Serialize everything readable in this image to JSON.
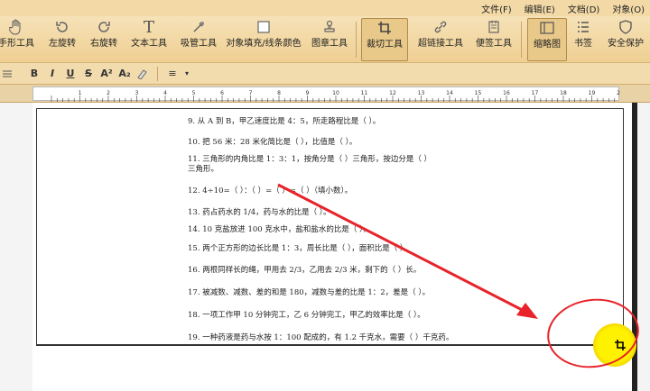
{
  "menu": [
    "文件(F)",
    "编辑(E)",
    "文档(D)",
    "对象(O)"
  ],
  "toolbar": [
    {
      "icon": "hand-icon",
      "label": "手形工具"
    },
    {
      "icon": "rotate-left-icon",
      "label": "左旋转"
    },
    {
      "icon": "rotate-right-icon",
      "label": "右旋转"
    },
    {
      "icon": "text-tool-icon",
      "label": "文本工具"
    },
    {
      "icon": "eyedropper-icon",
      "label": "吸管工具"
    },
    {
      "icon": "fill-stroke-icon",
      "label": "对象填充/线条颜色"
    },
    {
      "icon": "stamp-icon",
      "label": "图章工具"
    },
    {
      "icon": "crop-icon",
      "label": "裁切工具"
    },
    {
      "icon": "link-icon",
      "label": "超链接工具"
    },
    {
      "icon": "note-icon",
      "label": "便签工具"
    },
    {
      "icon": "thumbnail-icon",
      "label": "缩略图"
    },
    {
      "icon": "bookmark-icon",
      "label": "书签"
    },
    {
      "icon": "shield-icon",
      "label": "安全保护"
    }
  ],
  "format_bar": [
    "B",
    "I",
    "U",
    "S",
    "A²",
    "A₂",
    "≡"
  ],
  "ruler": {
    "ticks": [
      "1",
      "2",
      "3",
      "4",
      "5",
      "6",
      "7",
      "8",
      "9",
      "10",
      "11",
      "12",
      "13",
      "14",
      "15",
      "16",
      "17",
      "18",
      "19",
      "20"
    ]
  },
  "document": {
    "lines": [
      "9. 从 A 到 B，甲乙速度比是 4：5，所走路程比是（    ）。",
      "10. 把 56 米：28 米化简比是（    ），比值是（    ）。",
      "11. 三角形的内角比是 1：3：1，按角分是（    ）三角形，按边分是（    ）",
      "三角形。",
      "12. 4÷10=（  ）：（  ）=（ ）=（    ）（填小数）。",
      "13. 药占药水的 1/4，药与水的比是（    ）。",
      "14. 10 克盐放进 100 克水中，盐和盐水的比是（    ）。",
      "15. 两个正方形的边长比是 1：3，周长比是（    ），面积比是（    ）。",
      "16. 两根同样长的绳，甲用去 2/3，乙用去 2/3 米，剩下的（    ）长。",
      "17. 被减数、减数、差的和是 180，减数与差的比是 1：2，差是（    ）。",
      "18. 一项工作甲 10 分钟完工，乙 6 分钟完工，甲乙的效率比是（    ）。",
      "19. 一种药液是药与水按 1：100 配成的，有 1.2 千克水，需要（    ）千克药。"
    ]
  },
  "annotation_color": "#e8232a",
  "highlight_color": "#fff200"
}
